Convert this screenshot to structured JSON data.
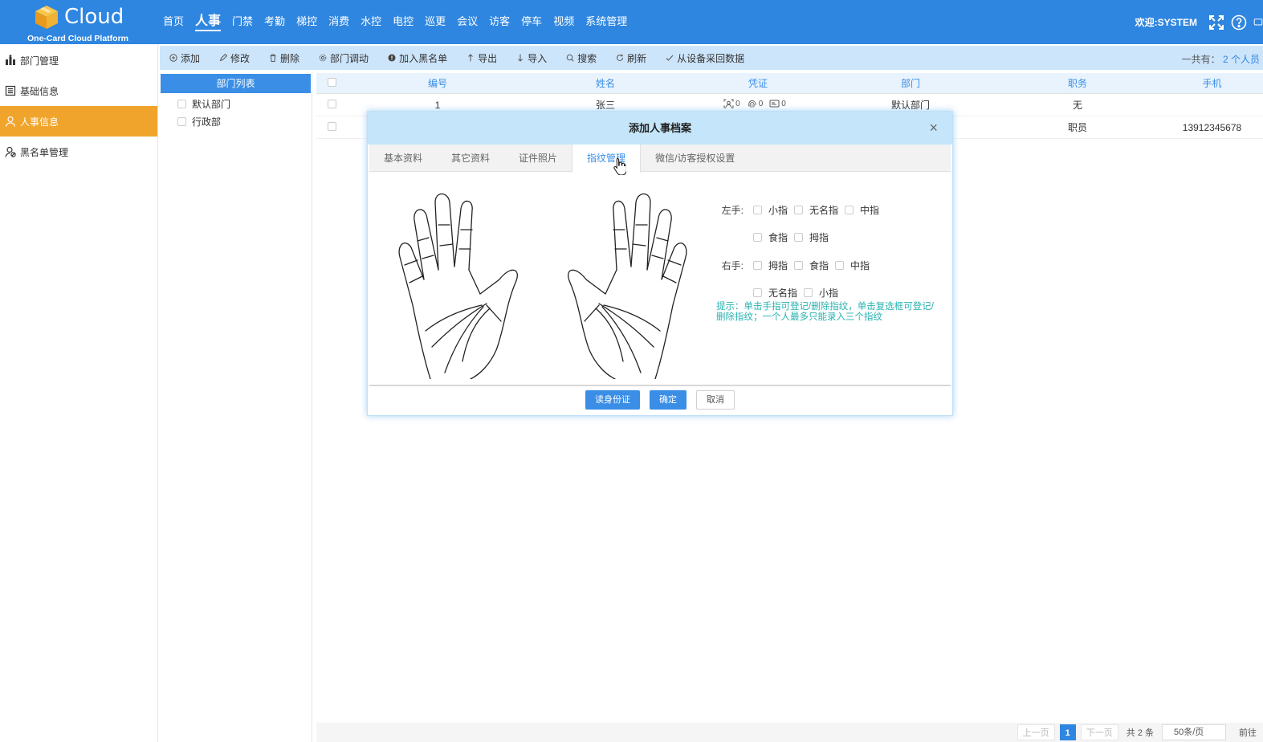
{
  "app": {
    "logo_text": "Cloud",
    "logo_sub": "One-Card Cloud Platform",
    "brand_color": "#2f86e0",
    "accent_color": "#f0a42b"
  },
  "nav": [
    "首页",
    "人事",
    "门禁",
    "考勤",
    "梯控",
    "消费",
    "水控",
    "电控",
    "巡更",
    "会议",
    "访客",
    "停车",
    "视频",
    "系统管理"
  ],
  "nav_active": "人事",
  "header": {
    "welcome": "欢迎:SYSTEM",
    "icons": [
      "fullscreen-icon",
      "help-icon",
      "message-icon"
    ]
  },
  "sidebar": {
    "items": [
      {
        "label": "部门管理",
        "icon": "org-icon"
      },
      {
        "label": "基础信息",
        "icon": "list-icon"
      },
      {
        "label": "人事信息",
        "icon": "user-icon",
        "active": true
      },
      {
        "label": "黑名单管理",
        "icon": "user-block-icon"
      }
    ]
  },
  "toolbar": {
    "buttons": [
      {
        "label": "添加",
        "icon": "plus-circle-icon"
      },
      {
        "label": "修改",
        "icon": "edit-icon"
      },
      {
        "label": "删除",
        "icon": "trash-icon"
      },
      {
        "label": "部门调动",
        "icon": "gear-icon"
      },
      {
        "label": "加入黑名单",
        "icon": "alert-icon"
      },
      {
        "label": "导出",
        "icon": "arrow-up-icon"
      },
      {
        "label": "导入",
        "icon": "arrow-down-icon"
      },
      {
        "label": "搜索",
        "icon": "search-icon"
      },
      {
        "label": "刷新",
        "icon": "refresh-icon"
      },
      {
        "label": "从设备采回数据",
        "icon": "check-icon"
      }
    ],
    "total_label": "一共有：",
    "total_value": "2 个人员"
  },
  "dept": {
    "title": "部门列表",
    "items": [
      "默认部门",
      "行政部"
    ]
  },
  "table": {
    "headers": [
      "编号",
      "姓名",
      "凭证",
      "部门",
      "职务",
      "手机"
    ],
    "rows": [
      {
        "id": "1",
        "name": "张三",
        "face": "0",
        "finger": "0",
        "card": "0",
        "dept": "默认部门",
        "position": "无",
        "phone": ""
      },
      {
        "id": "",
        "name": "",
        "face": "",
        "finger": "",
        "card": "",
        "dept": "",
        "position": "职员",
        "phone": "13912345678"
      }
    ]
  },
  "pagination": {
    "prev": "上一页",
    "current": "1",
    "next": "下一页",
    "total": "共 2 条",
    "page_size": "50条/页",
    "goto": "前往"
  },
  "modal": {
    "title": "添加人事档案",
    "tabs": [
      "基本资料",
      "其它资料",
      "证件照片",
      "指纹管理",
      "微信/访客授权设置"
    ],
    "active_tab": "指纹管理",
    "left_hand_label": "左手:",
    "right_hand_label": "右手:",
    "left_fingers": [
      "小指",
      "无名指",
      "中指",
      "食指",
      "拇指"
    ],
    "right_fingers": [
      "拇指",
      "食指",
      "中指",
      "无名指",
      "小指"
    ],
    "tip": "提示：单击手指可登记/删除指纹，单击复选框可登记/删除指纹；一个人最多只能录入三个指纹",
    "buttons": {
      "read_id": "读身份证",
      "confirm": "确定",
      "cancel": "取消"
    }
  }
}
